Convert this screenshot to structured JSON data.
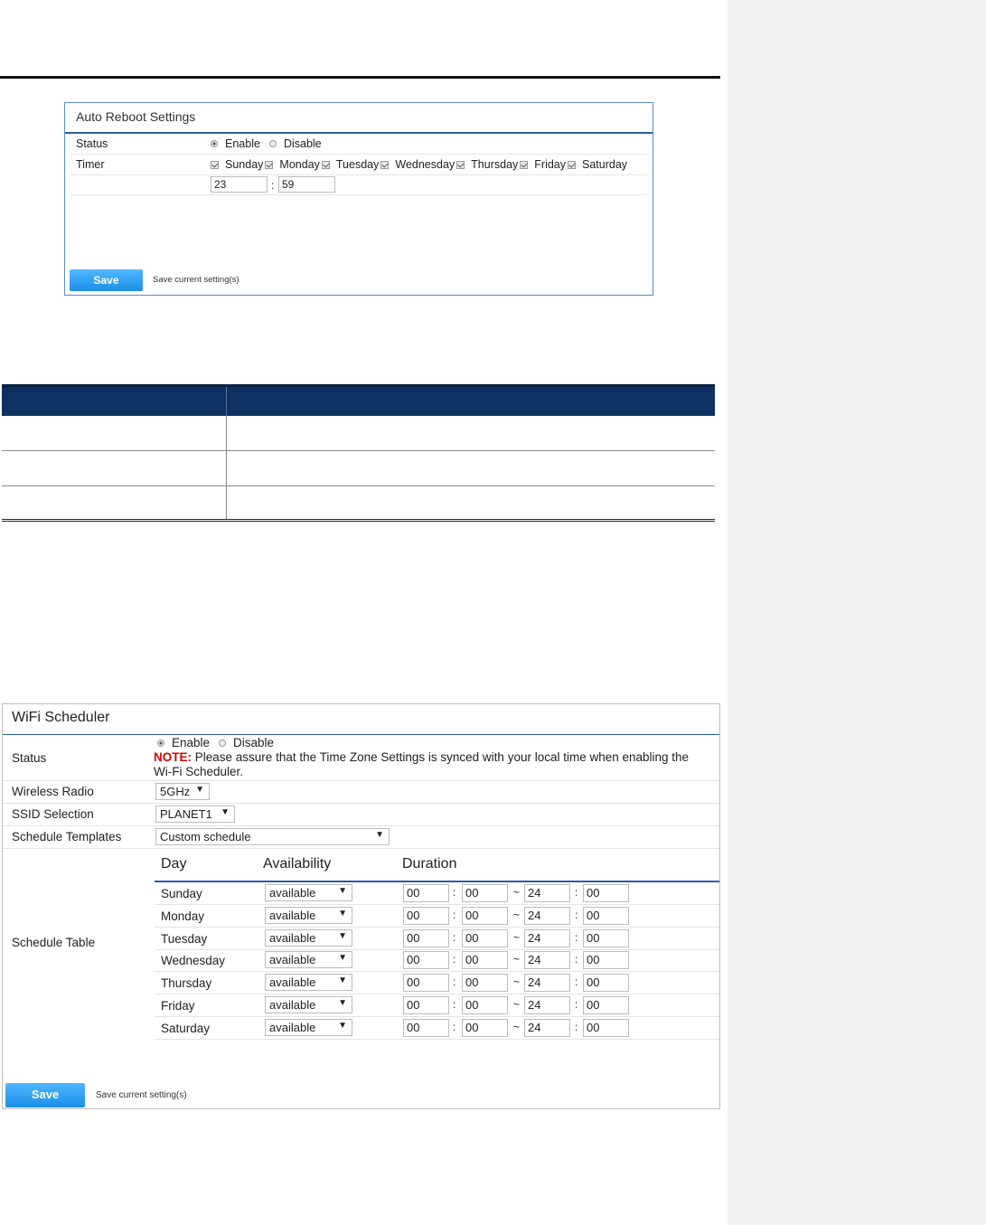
{
  "reboot": {
    "title": "Auto Reboot Settings",
    "status_label": "Status",
    "enable": "Enable",
    "disable": "Disable",
    "timer_label": "Timer",
    "days": [
      "Sunday",
      "Monday",
      "Tuesday",
      "Wednesday",
      "Thursday",
      "Friday",
      "Saturday"
    ],
    "hour": "23",
    "minute": "59",
    "colon": ":",
    "save": "Save",
    "save_note": "Save current setting(s)"
  },
  "wifi": {
    "title": "WiFi Scheduler",
    "status_label": "Status",
    "enable": "Enable",
    "disable": "Disable",
    "note_label": "NOTE:",
    "note_line1": "Please assure that the Time Zone Settings is synced with your local time when enabling the",
    "note_line2": "Wi-Fi Scheduler.",
    "radio_label": "Wireless Radio",
    "radio_value": "5GHz",
    "ssid_label": "SSID Selection",
    "ssid_value": "PLANET1",
    "template_label": "Schedule Templates",
    "template_value": "Custom schedule",
    "table_label": "Schedule Table",
    "col_day": "Day",
    "col_availability": "Availability",
    "col_duration": "Duration",
    "rows": [
      {
        "day": "Sunday",
        "avail": "available",
        "sh": "00",
        "sm": "00",
        "eh": "24",
        "em": "00"
      },
      {
        "day": "Monday",
        "avail": "available",
        "sh": "00",
        "sm": "00",
        "eh": "24",
        "em": "00"
      },
      {
        "day": "Tuesday",
        "avail": "available",
        "sh": "00",
        "sm": "00",
        "eh": "24",
        "em": "00"
      },
      {
        "day": "Wednesday",
        "avail": "available",
        "sh": "00",
        "sm": "00",
        "eh": "24",
        "em": "00"
      },
      {
        "day": "Thursday",
        "avail": "available",
        "sh": "00",
        "sm": "00",
        "eh": "24",
        "em": "00"
      },
      {
        "day": "Friday",
        "avail": "available",
        "sh": "00",
        "sm": "00",
        "eh": "24",
        "em": "00"
      },
      {
        "day": "Saturday",
        "avail": "available",
        "sh": "00",
        "sm": "00",
        "eh": "24",
        "em": "00"
      }
    ],
    "colon": ":",
    "tilde": "~",
    "arrow": "▼",
    "save": "Save",
    "save_note": "Save current setting(s)"
  }
}
